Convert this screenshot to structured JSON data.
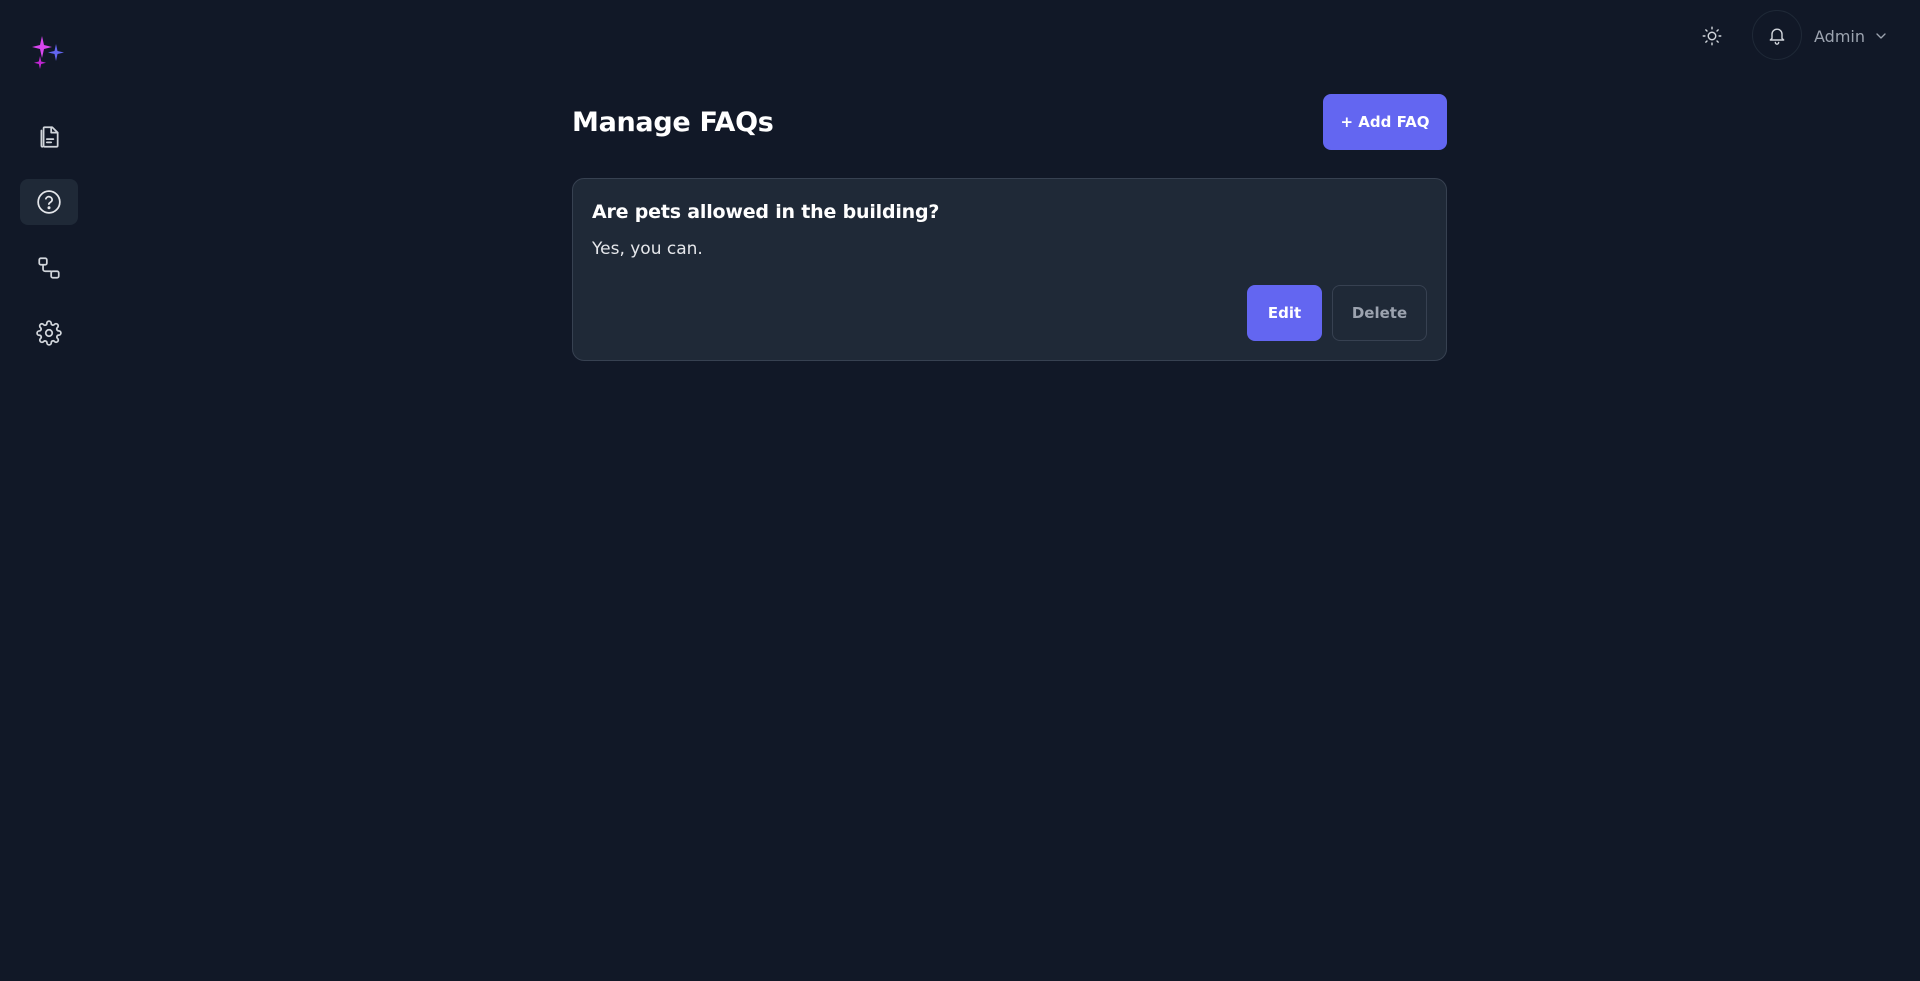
{
  "sidebar": {
    "logo_icon": "sparkles-icon",
    "items": [
      {
        "icon": "document-icon",
        "active": false
      },
      {
        "icon": "help-circle-icon",
        "active": true
      },
      {
        "icon": "workflow-icon",
        "active": false
      },
      {
        "icon": "gear-icon",
        "active": false
      }
    ]
  },
  "header": {
    "theme_icon": "sun-icon",
    "notification_icon": "bell-icon",
    "user_name": "Admin",
    "user_menu_icon": "chevron-down-icon"
  },
  "main": {
    "title": "Manage FAQs",
    "add_button_label": "+ Add FAQ",
    "faqs": [
      {
        "question": "Are pets allowed in the building?",
        "answer": "Yes, you can.",
        "edit_label": "Edit",
        "delete_label": "Delete"
      }
    ]
  },
  "colors": {
    "background": "#111827",
    "card": "#1f2937",
    "accent": "#6366f1",
    "logo_pink": "#d946ef",
    "logo_blue": "#6366f1"
  }
}
